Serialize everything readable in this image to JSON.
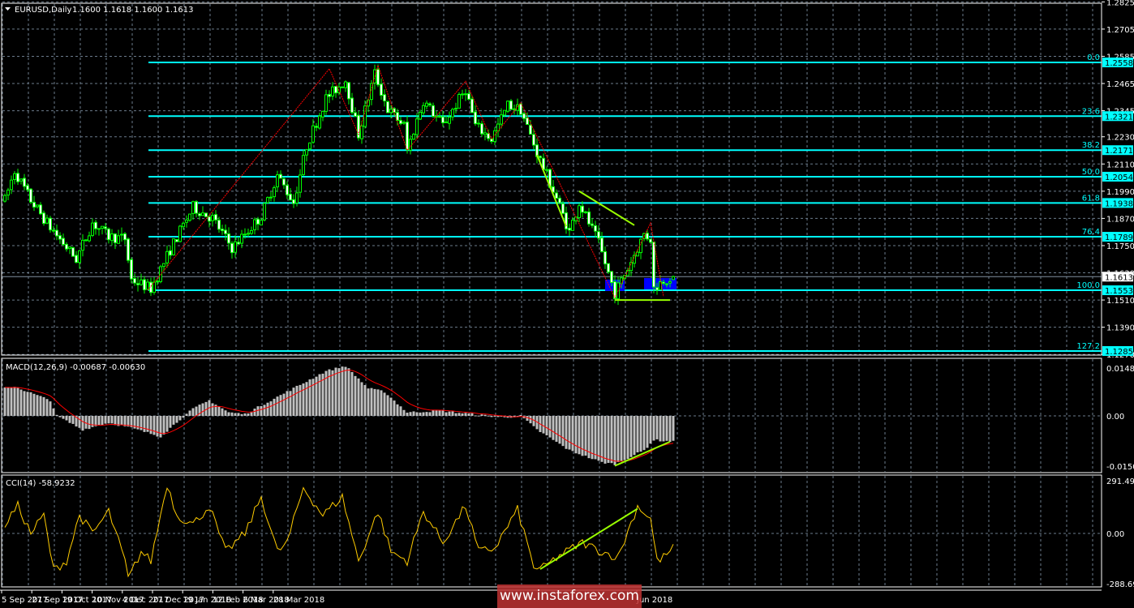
{
  "header": {
    "symbol": "EURUSD,Daily",
    "ohlc": "1.1600 1.1618 1.1600 1.1613"
  },
  "macd_label": "MACD(12,26,9) -0.00687 -0.00630",
  "cci_label": "CCI(14) -58.9232",
  "watermark": "www.instaforex.com",
  "colors": {
    "background": "#000000",
    "candle": "#00ff00",
    "fib": "#00ffff",
    "zigzag": "#ff0000",
    "trend": "#99ff00",
    "macd_hist": "#c0c0c0",
    "macd_signal": "#ff0000",
    "cci": "#ffcc00",
    "zone": "#0000ff"
  },
  "chart_data": {
    "type": "candlestick",
    "symbol": "EURUSD",
    "timeframe": "Daily",
    "last_bar": {
      "open": 1.16,
      "high": 1.1618,
      "low": 1.16,
      "close": 1.1613
    },
    "current_price": "1.1613",
    "price_axis": [
      "1.2825",
      "1.2705",
      "1.2585",
      "1.2465",
      "1.2345",
      "1.2230",
      "1.2110",
      "1.1990",
      "1.1870",
      "1.1750",
      "1.1630",
      "1.1510",
      "1.1390",
      "1.1270"
    ],
    "ylim": [
      1.1262,
      1.284
    ],
    "time_axis": [
      "5 Sep 2017",
      "27 Sep 2017",
      "19 Oct 2017",
      "10 Nov 2017",
      "4 Dec 2017",
      "27 Dec 2017",
      "19 Jan 2018",
      "12 Feb 2018",
      "6 Mar 2018",
      "28 Mar 2018",
      "Jun 2018"
    ],
    "price_path": [
      [
        0,
        1.195
      ],
      [
        3,
        1.208
      ],
      [
        8,
        1.195
      ],
      [
        14,
        1.183
      ],
      [
        22,
        1.169
      ],
      [
        27,
        1.185
      ],
      [
        32,
        1.179
      ],
      [
        37,
        1.178
      ],
      [
        39,
        1.16
      ],
      [
        45,
        1.156
      ],
      [
        52,
        1.176
      ],
      [
        58,
        1.192
      ],
      [
        64,
        1.187
      ],
      [
        70,
        1.174
      ],
      [
        74,
        1.18
      ],
      [
        79,
        1.188
      ],
      [
        84,
        1.206
      ],
      [
        89,
        1.194
      ],
      [
        93,
        1.219
      ],
      [
        99,
        1.24
      ],
      [
        105,
        1.248
      ],
      [
        109,
        1.224
      ],
      [
        114,
        1.251
      ],
      [
        118,
        1.235
      ],
      [
        123,
        1.228
      ],
      [
        124,
        1.217
      ],
      [
        129,
        1.239
      ],
      [
        135,
        1.228
      ],
      [
        142,
        1.244
      ],
      [
        145,
        1.228
      ],
      [
        150,
        1.222
      ],
      [
        155,
        1.237
      ],
      [
        159,
        1.235
      ],
      [
        164,
        1.216
      ],
      [
        170,
        1.196
      ],
      [
        174,
        1.181
      ],
      [
        177,
        1.194
      ],
      [
        183,
        1.176
      ],
      [
        188,
        1.154
      ],
      [
        192,
        1.165
      ],
      [
        197,
        1.18
      ],
      [
        199,
        1.178
      ],
      [
        200,
        1.156
      ],
      [
        203,
        1.16
      ],
      [
        206,
        1.1613
      ]
    ],
    "fibonacci": [
      {
        "level": "0.0",
        "price": "1.2558"
      },
      {
        "level": "23.6",
        "price": "1.2321"
      },
      {
        "level": "38.2",
        "price": "1.2171"
      },
      {
        "level": "50.0",
        "price": "1.2054"
      },
      {
        "level": "61.8",
        "price": "1.1938"
      },
      {
        "level": "76.4",
        "price": "1.1789"
      },
      {
        "level": "100.0",
        "price": "1.1553"
      },
      {
        "level": "127.2",
        "price": "1.1285"
      }
    ],
    "zigzag": [
      [
        44,
        1.1553
      ],
      [
        100,
        1.253
      ],
      [
        109,
        1.224
      ],
      [
        115,
        1.2545
      ],
      [
        124,
        1.217
      ],
      [
        142,
        1.2475
      ],
      [
        150,
        1.222
      ],
      [
        159,
        1.238
      ],
      [
        188,
        1.152
      ],
      [
        199,
        1.185
      ],
      [
        203,
        1.1525
      ]
    ],
    "trendlines": [
      {
        "pane": "price",
        "points": [
          [
            164,
            1.215
          ],
          [
            173,
            1.1835
          ]
        ]
      },
      {
        "pane": "price",
        "points": [
          [
            177,
            1.199
          ],
          [
            194,
            1.184
          ]
        ]
      },
      {
        "pane": "price",
        "points": [
          [
            188,
            1.151
          ],
          [
            205,
            1.151
          ]
        ]
      },
      {
        "pane": "macd",
        "points": [
          [
            188,
            -0.0145
          ],
          [
            205,
            -0.0075
          ]
        ]
      },
      {
        "pane": "cci",
        "points": [
          [
            165,
            -195
          ],
          [
            195,
            135
          ]
        ]
      }
    ],
    "zones": [
      [
        185,
        191,
        1.16,
        1.155
      ],
      [
        197,
        207,
        1.1607,
        1.1557
      ]
    ],
    "macd": {
      "params": "12,26,9",
      "ylim": [
        -0.01509,
        0.01482
      ],
      "axis": [
        "0.01482",
        "0.00",
        "-0.01509"
      ],
      "histogram_path": [
        [
          0,
          0.008
        ],
        [
          3,
          0.0085
        ],
        [
          14,
          0.0045
        ],
        [
          16,
          0
        ],
        [
          24,
          -0.004
        ],
        [
          32,
          -0.002
        ],
        [
          39,
          -0.0035
        ],
        [
          48,
          -0.006
        ],
        [
          54,
          -0.001
        ],
        [
          58,
          0.002
        ],
        [
          63,
          0.0045
        ],
        [
          69,
          0.001
        ],
        [
          74,
          0.0005
        ],
        [
          81,
          0.004
        ],
        [
          89,
          0.008
        ],
        [
          99,
          0.013
        ],
        [
          105,
          0.0145
        ],
        [
          112,
          0.008
        ],
        [
          117,
          0.007
        ],
        [
          124,
          0.001
        ],
        [
          134,
          0.0015
        ],
        [
          144,
          0.0005
        ],
        [
          154,
          -0.0005
        ],
        [
          159,
          0
        ],
        [
          164,
          -0.004
        ],
        [
          174,
          -0.01
        ],
        [
          184,
          -0.0135
        ],
        [
          188,
          -0.014
        ],
        [
          197,
          -0.01
        ],
        [
          200,
          -0.007
        ],
        [
          206,
          -0.0075
        ]
      ]
    },
    "cci": {
      "period": 14,
      "ylim": [
        -288.693,
        291.4917
      ],
      "axis": [
        "291.4917",
        "0.00",
        "-288.693"
      ],
      "path": [
        [
          0,
          50
        ],
        [
          4,
          150
        ],
        [
          8,
          0
        ],
        [
          12,
          100
        ],
        [
          15,
          -200
        ],
        [
          19,
          -150
        ],
        [
          23,
          100
        ],
        [
          27,
          0
        ],
        [
          32,
          120
        ],
        [
          37,
          -150
        ],
        [
          38,
          -250
        ],
        [
          42,
          -100
        ],
        [
          45,
          -150
        ],
        [
          50,
          270
        ],
        [
          53,
          100
        ],
        [
          58,
          50
        ],
        [
          63,
          150
        ],
        [
          68,
          -100
        ],
        [
          74,
          0
        ],
        [
          79,
          200
        ],
        [
          84,
          -100
        ],
        [
          87,
          -50
        ],
        [
          92,
          250
        ],
        [
          98,
          100
        ],
        [
          104,
          200
        ],
        [
          109,
          -150
        ],
        [
          115,
          120
        ],
        [
          119,
          -100
        ],
        [
          124,
          -150
        ],
        [
          129,
          120
        ],
        [
          135,
          -50
        ],
        [
          142,
          150
        ],
        [
          146,
          -100
        ],
        [
          151,
          -80
        ],
        [
          158,
          130
        ],
        [
          163,
          -180
        ],
        [
          165,
          -200
        ],
        [
          171,
          -120
        ],
        [
          178,
          -50
        ],
        [
          184,
          -100
        ],
        [
          189,
          -130
        ],
        [
          195,
          150
        ],
        [
          199,
          80
        ],
        [
          201,
          -150
        ],
        [
          203,
          -130
        ],
        [
          206,
          -80
        ]
      ]
    }
  }
}
